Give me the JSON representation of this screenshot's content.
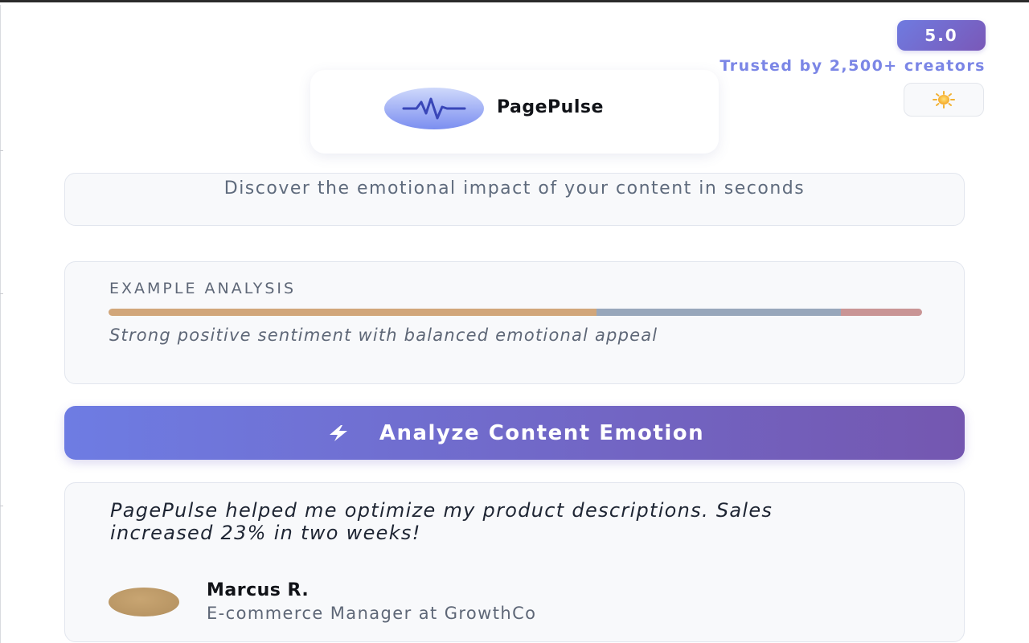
{
  "header": {
    "rating": "5.0",
    "trusted_text": "Trusted by 2,500+ creators",
    "theme_toggle_icon": "sun-icon"
  },
  "brand": {
    "name": "PagePulse",
    "logo_icon": "pulse-wave-icon",
    "logo_color": "#7b8ef0"
  },
  "tagline": "Discover the emotional impact of your content in seconds",
  "example": {
    "title": "EXAMPLE ANALYSIS",
    "segments": [
      {
        "fraction": 0.6,
        "color": "#d1a67a"
      },
      {
        "fraction": 0.3,
        "color": "#98a7bb"
      },
      {
        "fraction": 0.1,
        "color": "#c99595"
      }
    ],
    "description": "Strong positive sentiment with balanced emotional appeal"
  },
  "cta": {
    "label": "Analyze Content Emotion",
    "icon": "lightning-bolt-icon"
  },
  "testimonial": {
    "quote": "PagePulse helped me optimize my product descriptions. Sales increased 23% in two weeks!",
    "author_name": "Marcus R.",
    "author_role": "E-commerce Manager at GrowthCo"
  },
  "colors": {
    "accent_start": "#6e7ce3",
    "accent_end": "#7457b0",
    "trusted_text": "#7b86e6"
  }
}
